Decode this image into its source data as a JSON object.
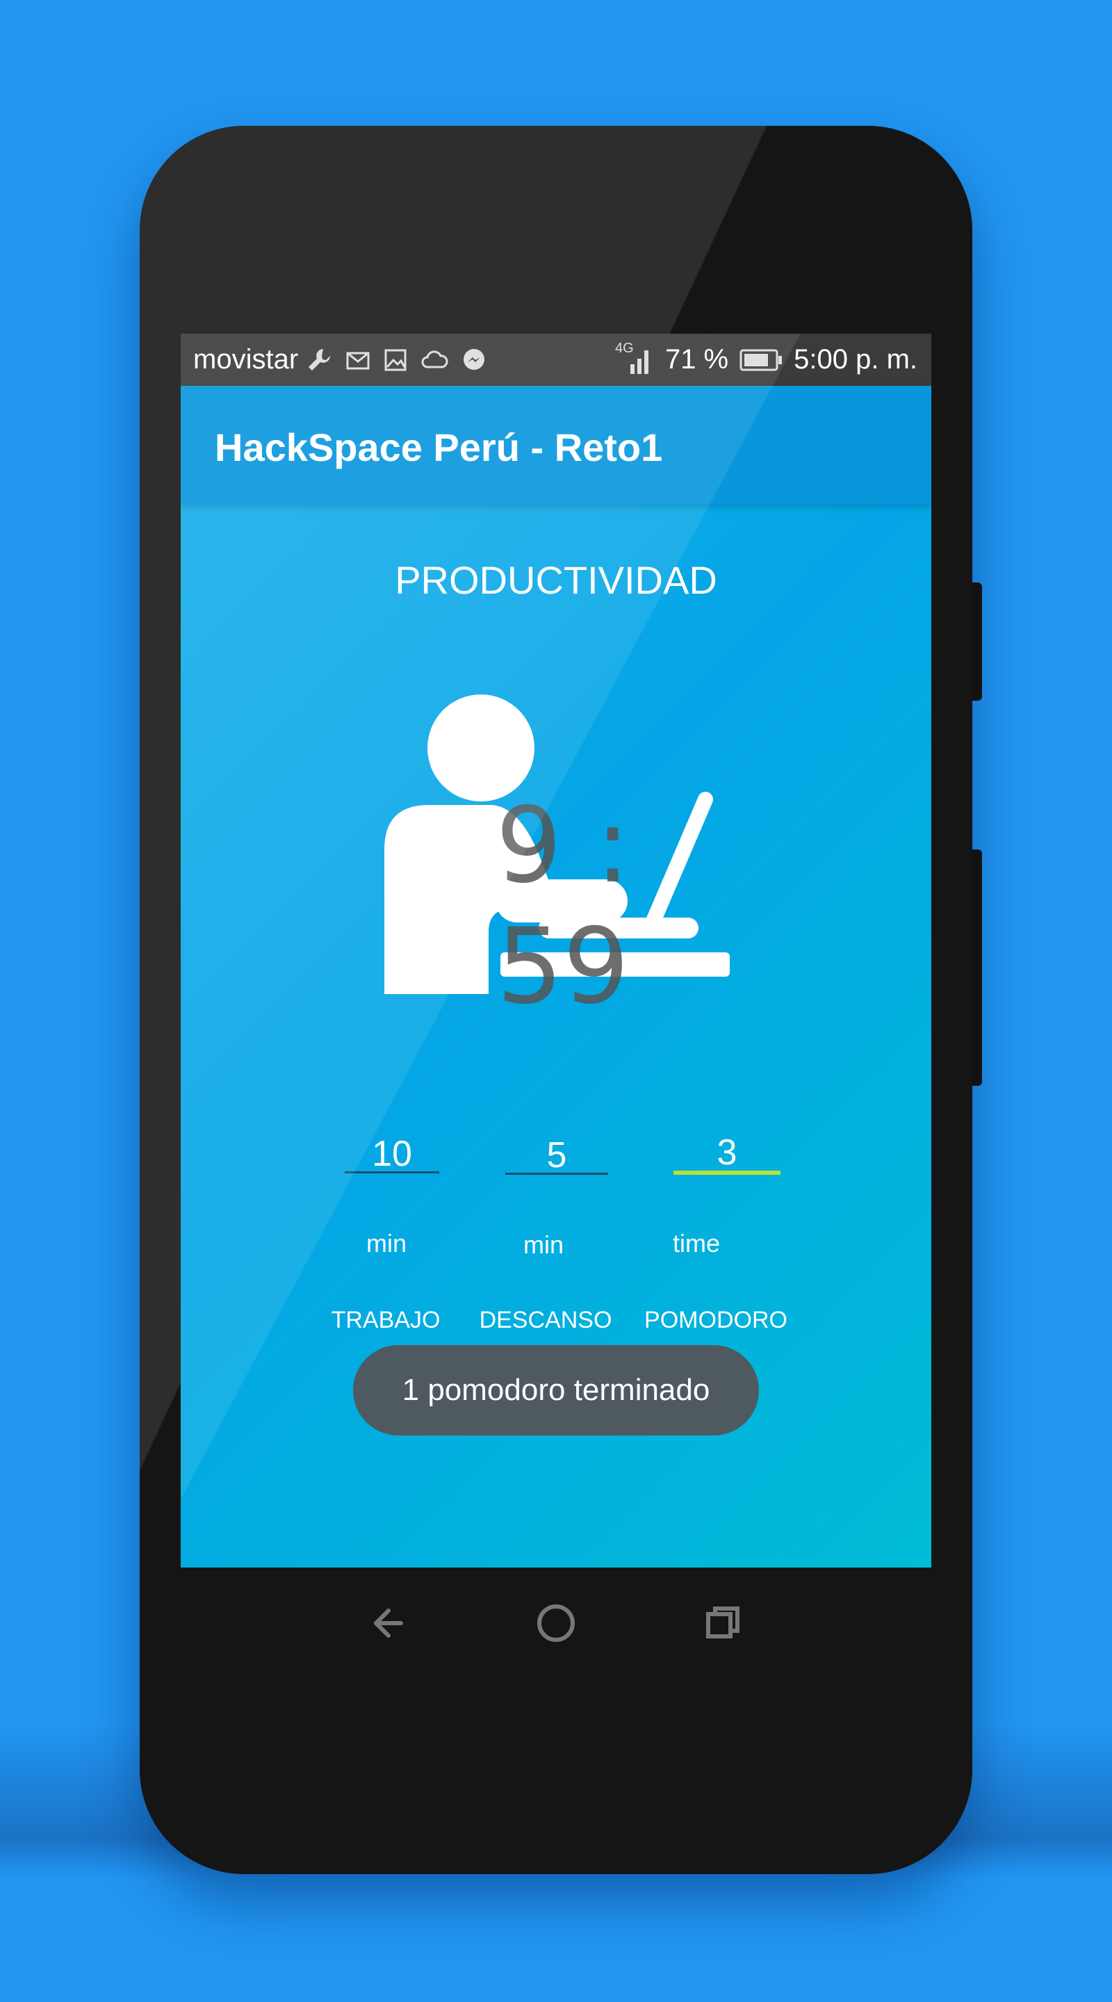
{
  "status_bar": {
    "carrier": "movistar",
    "network": "4G",
    "battery_text": "71 %",
    "time": "5:00 p. m.",
    "icons": [
      "wrench-icon",
      "mail-icon",
      "image-icon",
      "cloud-icon",
      "messenger-icon",
      "signal-icon",
      "battery-icon"
    ]
  },
  "app_bar": {
    "title": "HackSpace Perú - Reto1"
  },
  "main": {
    "heading": "PRODUCTIVIDAD",
    "timer": "9 : 59",
    "fields": [
      {
        "value": "10",
        "unit": "min",
        "label": "TRABAJO"
      },
      {
        "value": "5",
        "unit": "min",
        "label": "DESCANSO"
      },
      {
        "value": "3",
        "unit": "time",
        "label": "POMODORO"
      }
    ]
  },
  "toast": {
    "message": "1 pomodoro terminado"
  },
  "nav_bar": {
    "icons": [
      "back-icon",
      "home-icon",
      "recents-icon"
    ]
  },
  "colors": {
    "background": "#2196f3",
    "app_bar": "#0897dd",
    "active_underline": "#b6e23a",
    "toast": "#4e5a5f"
  }
}
